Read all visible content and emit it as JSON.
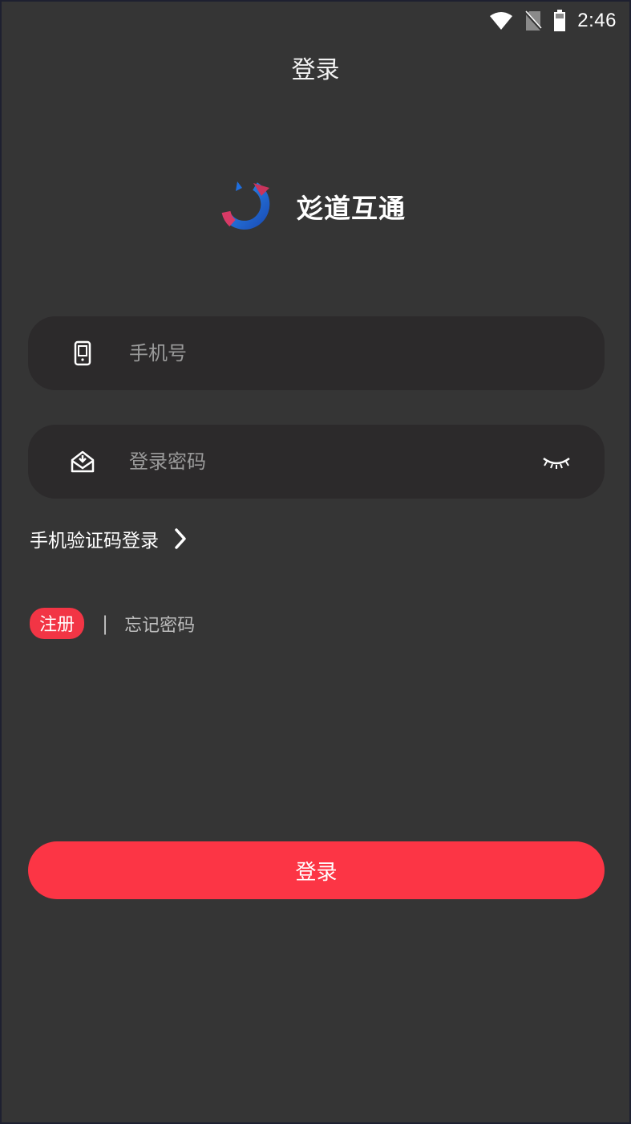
{
  "status_bar": {
    "time": "2:46",
    "icons": [
      "wifi-icon",
      "no-sim-icon",
      "battery-icon"
    ]
  },
  "header": {
    "title": "登录"
  },
  "brand": {
    "name": "彣道互通",
    "logo_icon": "brand-logo-icon"
  },
  "form": {
    "phone": {
      "placeholder": "手机号",
      "value": "",
      "icon": "phone-icon"
    },
    "password": {
      "placeholder": "登录密码",
      "value": "",
      "icon": "lock-icon",
      "toggle_icon": "eye-closed-icon"
    }
  },
  "sms_login": {
    "label": "手机验证码登录",
    "icon": "chevron-right-icon"
  },
  "links": {
    "register": "注册",
    "divider": "|",
    "forgot_password": "忘记密码"
  },
  "login_button": {
    "label": "登录"
  },
  "colors": {
    "background": "#353535",
    "field_background": "#2c2a2b",
    "accent": "#fc3545",
    "placeholder": "#9a9a9a"
  }
}
